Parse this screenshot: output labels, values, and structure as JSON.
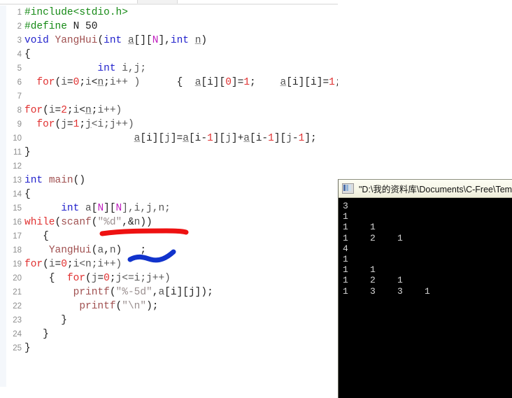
{
  "editor": {
    "name": "c-free-code-editor",
    "language": "C",
    "lines": [
      {
        "n": "1",
        "tokens": [
          {
            "t": "#include<stdio.h>",
            "c": "t-pre"
          }
        ]
      },
      {
        "n": "2",
        "tokens": [
          {
            "t": "#define",
            "c": "t-pre"
          },
          {
            "t": " ",
            "c": "t-plain"
          },
          {
            "t": "N",
            "c": "t-plain"
          },
          {
            "t": " ",
            "c": "t-plain"
          },
          {
            "t": "50",
            "c": "t-plain"
          }
        ]
      },
      {
        "n": "3",
        "tokens": [
          {
            "t": "void",
            "c": "t-kw"
          },
          {
            "t": " ",
            "c": "t-plain"
          },
          {
            "t": "YangHui",
            "c": "t-fn"
          },
          {
            "t": "(",
            "c": "t-punct"
          },
          {
            "t": "int",
            "c": "t-kw"
          },
          {
            "t": " ",
            "c": "t-plain"
          },
          {
            "t": "a",
            "c": "t-var"
          },
          {
            "t": "[][",
            "c": "t-punct"
          },
          {
            "t": "N",
            "c": "t-macro"
          },
          {
            "t": "],",
            "c": "t-punct"
          },
          {
            "t": "int",
            "c": "t-kw"
          },
          {
            "t": " ",
            "c": "t-plain"
          },
          {
            "t": "n",
            "c": "t-var"
          },
          {
            "t": ")",
            "c": "t-punct"
          }
        ]
      },
      {
        "n": "4",
        "tokens": [
          {
            "t": "{",
            "c": "t-plain"
          }
        ]
      },
      {
        "n": "5",
        "tokens": [
          {
            "t": "            ",
            "c": "t-plain"
          },
          {
            "t": "int",
            "c": "t-kw"
          },
          {
            "t": " ",
            "c": "t-plain"
          },
          {
            "t": "i,j;",
            "c": "t-id"
          }
        ]
      },
      {
        "n": "6",
        "tokens": [
          {
            "t": "  ",
            "c": "t-plain"
          },
          {
            "t": "for",
            "c": "t-loop"
          },
          {
            "t": "(",
            "c": "t-punct"
          },
          {
            "t": "i",
            "c": "t-id"
          },
          {
            "t": "=",
            "c": "t-punct"
          },
          {
            "t": "0",
            "c": "t-num"
          },
          {
            "t": ";",
            "c": "t-punct"
          },
          {
            "t": "i",
            "c": "t-id"
          },
          {
            "t": "<",
            "c": "t-punct"
          },
          {
            "t": "n",
            "c": "t-var"
          },
          {
            "t": ";",
            "c": "t-punct"
          },
          {
            "t": "i++ )",
            "c": "t-id"
          },
          {
            "t": "      {  ",
            "c": "t-plain"
          },
          {
            "t": "a",
            "c": "t-var"
          },
          {
            "t": "[i][",
            "c": "t-punct"
          },
          {
            "t": "0",
            "c": "t-num"
          },
          {
            "t": "]=",
            "c": "t-punct"
          },
          {
            "t": "1",
            "c": "t-num"
          },
          {
            "t": ";    ",
            "c": "t-punct"
          },
          {
            "t": "a",
            "c": "t-var"
          },
          {
            "t": "[i][i]=",
            "c": "t-punct"
          },
          {
            "t": "1",
            "c": "t-num"
          },
          {
            "t": ";   }",
            "c": "t-punct"
          }
        ]
      },
      {
        "n": "7",
        "tokens": [
          {
            "t": "",
            "c": "t-plain"
          }
        ]
      },
      {
        "n": "8",
        "tokens": [
          {
            "t": "for",
            "c": "t-loop"
          },
          {
            "t": "(",
            "c": "t-punct"
          },
          {
            "t": "i",
            "c": "t-id"
          },
          {
            "t": "=",
            "c": "t-punct"
          },
          {
            "t": "2",
            "c": "t-num"
          },
          {
            "t": ";",
            "c": "t-punct"
          },
          {
            "t": "i",
            "c": "t-id"
          },
          {
            "t": "<",
            "c": "t-punct"
          },
          {
            "t": "n",
            "c": "t-var"
          },
          {
            "t": ";",
            "c": "t-punct"
          },
          {
            "t": "i++)",
            "c": "t-id"
          }
        ]
      },
      {
        "n": "9",
        "tokens": [
          {
            "t": "  ",
            "c": "t-plain"
          },
          {
            "t": "for",
            "c": "t-loop"
          },
          {
            "t": "(",
            "c": "t-punct"
          },
          {
            "t": "j",
            "c": "t-id"
          },
          {
            "t": "=",
            "c": "t-punct"
          },
          {
            "t": "1",
            "c": "t-num"
          },
          {
            "t": ";",
            "c": "t-punct"
          },
          {
            "t": "j",
            "c": "t-var"
          },
          {
            "t": "<i;j++)",
            "c": "t-id"
          }
        ]
      },
      {
        "n": "10",
        "tokens": [
          {
            "t": "                  ",
            "c": "t-plain"
          },
          {
            "t": "a",
            "c": "t-var"
          },
          {
            "t": "[i][",
            "c": "t-punct"
          },
          {
            "t": "j",
            "c": "t-id"
          },
          {
            "t": "]=",
            "c": "t-punct"
          },
          {
            "t": "a",
            "c": "t-var"
          },
          {
            "t": "[i-",
            "c": "t-punct"
          },
          {
            "t": "1",
            "c": "t-num"
          },
          {
            "t": "][",
            "c": "t-punct"
          },
          {
            "t": "j",
            "c": "t-id"
          },
          {
            "t": "]+",
            "c": "t-punct"
          },
          {
            "t": "a",
            "c": "t-var"
          },
          {
            "t": "[i-",
            "c": "t-punct"
          },
          {
            "t": "1",
            "c": "t-num"
          },
          {
            "t": "][",
            "c": "t-punct"
          },
          {
            "t": "j",
            "c": "t-id"
          },
          {
            "t": "-",
            "c": "t-punct"
          },
          {
            "t": "1",
            "c": "t-num"
          },
          {
            "t": "];",
            "c": "t-punct"
          }
        ]
      },
      {
        "n": "11",
        "tokens": [
          {
            "t": "}",
            "c": "t-plain"
          }
        ]
      },
      {
        "n": "12",
        "tokens": [
          {
            "t": "",
            "c": "t-plain"
          }
        ]
      },
      {
        "n": "13",
        "tokens": [
          {
            "t": "int",
            "c": "t-kw"
          },
          {
            "t": " ",
            "c": "t-plain"
          },
          {
            "t": "main",
            "c": "t-fn"
          },
          {
            "t": "()",
            "c": "t-punct"
          }
        ]
      },
      {
        "n": "14",
        "tokens": [
          {
            "t": "{",
            "c": "t-plain"
          }
        ]
      },
      {
        "n": "15",
        "tokens": [
          {
            "t": "      ",
            "c": "t-plain"
          },
          {
            "t": "int",
            "c": "t-kw"
          },
          {
            "t": " ",
            "c": "t-plain"
          },
          {
            "t": "a",
            "c": "t-id"
          },
          {
            "t": "[",
            "c": "t-punct"
          },
          {
            "t": "N",
            "c": "t-macro"
          },
          {
            "t": "][",
            "c": "t-punct"
          },
          {
            "t": "N",
            "c": "t-macro"
          },
          {
            "t": "],i,j,n;",
            "c": "t-id"
          }
        ]
      },
      {
        "n": "16",
        "tokens": [
          {
            "t": "while",
            "c": "t-loop"
          },
          {
            "t": "(",
            "c": "t-punct"
          },
          {
            "t": "scanf",
            "c": "t-fn"
          },
          {
            "t": "(",
            "c": "t-punct"
          },
          {
            "t": "\"%d\"",
            "c": "t-str"
          },
          {
            "t": ",&",
            "c": "t-punct"
          },
          {
            "t": "n",
            "c": "t-id"
          },
          {
            "t": "))",
            "c": "t-punct"
          }
        ]
      },
      {
        "n": "17",
        "tokens": [
          {
            "t": "   {",
            "c": "t-plain"
          }
        ]
      },
      {
        "n": "18",
        "tokens": [
          {
            "t": "    ",
            "c": "t-plain"
          },
          {
            "t": "YangHui",
            "c": "t-fn"
          },
          {
            "t": "(",
            "c": "t-punct"
          },
          {
            "t": "a",
            "c": "t-id"
          },
          {
            "t": ",",
            "c": "t-punct"
          },
          {
            "t": "n",
            "c": "t-id"
          },
          {
            "t": ")   ;",
            "c": "t-punct"
          }
        ]
      },
      {
        "n": "19",
        "tokens": [
          {
            "t": "for",
            "c": "t-loop"
          },
          {
            "t": "(",
            "c": "t-punct"
          },
          {
            "t": "i",
            "c": "t-id"
          },
          {
            "t": "=",
            "c": "t-punct"
          },
          {
            "t": "0",
            "c": "t-num"
          },
          {
            "t": ";",
            "c": "t-punct"
          },
          {
            "t": "i",
            "c": "t-id"
          },
          {
            "t": "<n;i++)",
            "c": "t-id"
          }
        ]
      },
      {
        "n": "20",
        "tokens": [
          {
            "t": "    {  ",
            "c": "t-plain"
          },
          {
            "t": "for",
            "c": "t-loop"
          },
          {
            "t": "(",
            "c": "t-punct"
          },
          {
            "t": "j",
            "c": "t-id"
          },
          {
            "t": "=",
            "c": "t-punct"
          },
          {
            "t": "0",
            "c": "t-num"
          },
          {
            "t": ";",
            "c": "t-punct"
          },
          {
            "t": "j",
            "c": "t-id"
          },
          {
            "t": "<=i;j++)",
            "c": "t-id"
          }
        ]
      },
      {
        "n": "21",
        "tokens": [
          {
            "t": "        ",
            "c": "t-plain"
          },
          {
            "t": "printf",
            "c": "t-fn"
          },
          {
            "t": "(",
            "c": "t-punct"
          },
          {
            "t": "\"%-5d\"",
            "c": "t-str"
          },
          {
            "t": ",",
            "c": "t-punct"
          },
          {
            "t": "a",
            "c": "t-id"
          },
          {
            "t": "[i][j]);",
            "c": "t-punct"
          }
        ]
      },
      {
        "n": "22",
        "tokens": [
          {
            "t": "         ",
            "c": "t-plain"
          },
          {
            "t": "printf",
            "c": "t-fn"
          },
          {
            "t": "(",
            "c": "t-punct"
          },
          {
            "t": "\"\\n\"",
            "c": "t-str"
          },
          {
            "t": ");",
            "c": "t-punct"
          }
        ]
      },
      {
        "n": "23",
        "tokens": [
          {
            "t": "      }",
            "c": "t-plain"
          }
        ]
      },
      {
        "n": "24",
        "tokens": [
          {
            "t": "   }",
            "c": "t-plain"
          }
        ]
      },
      {
        "n": "25",
        "tokens": [
          {
            "t": "}",
            "c": "t-plain"
          }
        ]
      }
    ]
  },
  "annotations": {
    "red_underline": {
      "color": "#ee1111",
      "label": "red-underline-mark"
    },
    "blue_check": {
      "color": "#1133cc",
      "label": "blue-curve-mark"
    }
  },
  "console": {
    "title": "\"D:\\我的资料库\\Documents\\C-Free\\Tem",
    "icon": "console-window-icon",
    "output_lines": [
      "3",
      "1",
      "1    1",
      "1    2    1",
      "4",
      "1",
      "1    1",
      "1    2    1",
      "1    3    3    1"
    ]
  }
}
